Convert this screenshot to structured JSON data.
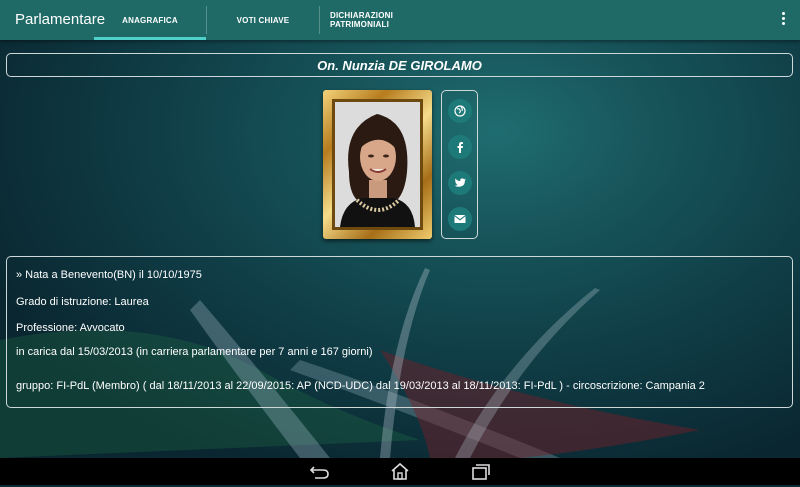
{
  "app": {
    "title": "Parlamentare"
  },
  "tabs": [
    {
      "label": "ANAGRAFICA",
      "active": true
    },
    {
      "label": "VOTI CHIAVE",
      "active": false
    },
    {
      "label_line1": "DICHIARAZIONI",
      "label_line2": "PATRIMONIALI",
      "active": false
    }
  ],
  "profile": {
    "name": "On. Nunzia DE GIROLAMO",
    "birth": "»  Nata a Benevento(BN) il 10/10/1975",
    "education": "Grado di istruzione: Laurea",
    "profession": "Professione: Avvocato",
    "in_office": "in carica dal 15/03/2013 (in carriera parlamentare per 7 anni e 167 giorni)",
    "group": "gruppo: FI-PdL (Membro) ( dal 18/11/2013 al 22/09/2015: AP (NCD-UDC) dal 19/03/2013 al 18/11/2013: FI-PdL ) - circoscrizione: Campania 2"
  },
  "social_icons": [
    "globe-icon",
    "facebook-icon",
    "twitter-icon",
    "mail-icon"
  ],
  "colors": {
    "appbar": "#1f6a67",
    "tab_indicator": "#4fd1c9",
    "social_button": "#1e7a78",
    "frame_gold": "#c8932d"
  }
}
